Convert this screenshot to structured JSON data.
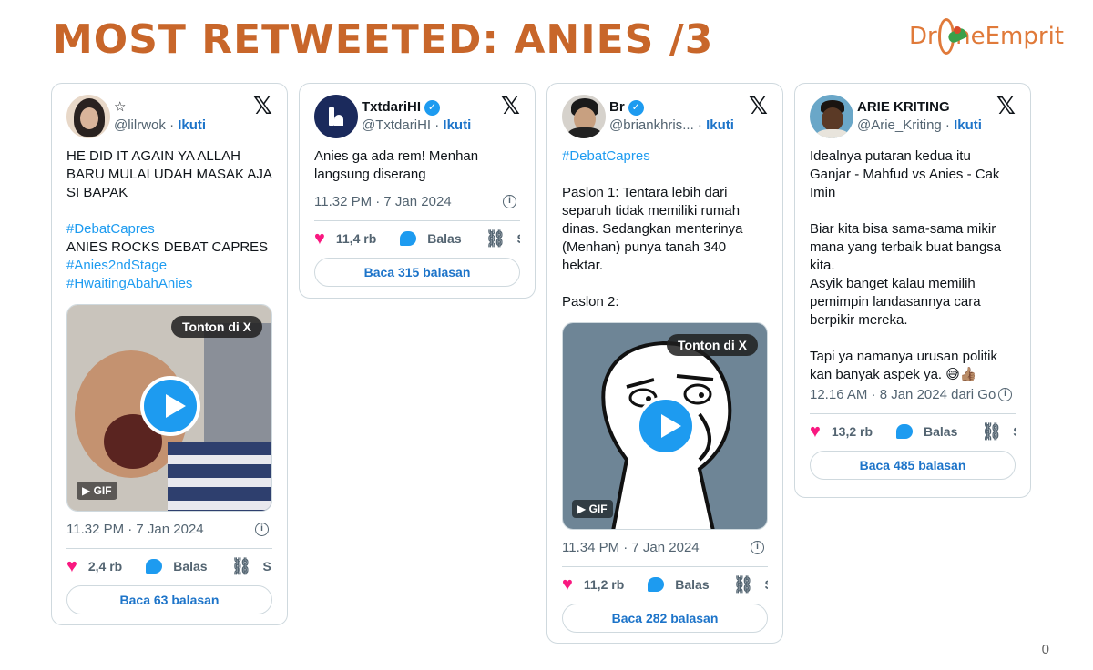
{
  "slide": {
    "title": "MOST RETWEETED: ANIES /3",
    "logo_left": "Dr",
    "logo_right": "neEmprit",
    "page_number": "0"
  },
  "colors": {
    "title": "#c8662a",
    "link": "#1d9bf0",
    "heart": "#f91880",
    "button_text": "#1d74c9"
  },
  "common": {
    "follow": "Ikuti",
    "reply": "Balas",
    "share": "S",
    "watch_on_x": "Tonton di X",
    "gif": "GIF",
    "x_logo": "𝕏",
    "sep": " · "
  },
  "tweets": [
    {
      "display_name": "☆",
      "verified": false,
      "handle": "@lilrwok",
      "lines": [
        "HE DID IT AGAIN YA ALLAH",
        "BARU MULAI UDAH MASAK AJA",
        "SI BAPAK",
        "",
        "#DebatCapres",
        "ANIES ROCKS DEBAT CAPRES",
        "#Anies2ndStage",
        "#HwaitingAbahAnies"
      ],
      "timestamp": "11.32 PM · 7 Jan 2024",
      "likes": "2,4 rb",
      "read_replies": "Baca 63 balasan"
    },
    {
      "display_name": "TxtdariHI",
      "verified": true,
      "handle": "@TxtdariHI",
      "lines": [
        "Anies ga ada rem! Menhan",
        "langsung diserang"
      ],
      "timestamp": "11.32 PM · 7 Jan 2024",
      "likes": "11,4 rb",
      "read_replies": "Baca 315 balasan"
    },
    {
      "display_name": "Br",
      "verified": true,
      "handle": "@briankhris...",
      "lines": [
        "#DebatCapres",
        "",
        "Paslon 1: Tentara lebih dari",
        "separuh tidak memiliki rumah",
        "dinas. Sedangkan menterinya",
        "(Menhan) punya tanah 340",
        "hektar.",
        "",
        "Paslon 2:"
      ],
      "timestamp": "11.34 PM · 7 Jan 2024",
      "likes": "11,2 rb",
      "read_replies": "Baca 282 balasan"
    },
    {
      "display_name": "ARIE KRITING",
      "verified": false,
      "handle": "@Arie_Kriting",
      "lines": [
        "Idealnya putaran kedua itu",
        "Ganjar - Mahfud vs Anies - Cak",
        "Imin",
        "",
        "Biar kita bisa sama-sama mikir",
        "mana yang terbaik buat bangsa",
        "kita.",
        "Asyik banget kalau memilih",
        "pemimpin landasannya cara",
        "berpikir mereka.",
        "",
        "Tapi ya namanya urusan politik",
        "kan banyak aspek ya. 😅👍🏽"
      ],
      "timestamp": "12.16 AM · 8 Jan 2024 dari Go",
      "likes": "13,2 rb",
      "read_replies": "Baca 485 balasan"
    }
  ]
}
